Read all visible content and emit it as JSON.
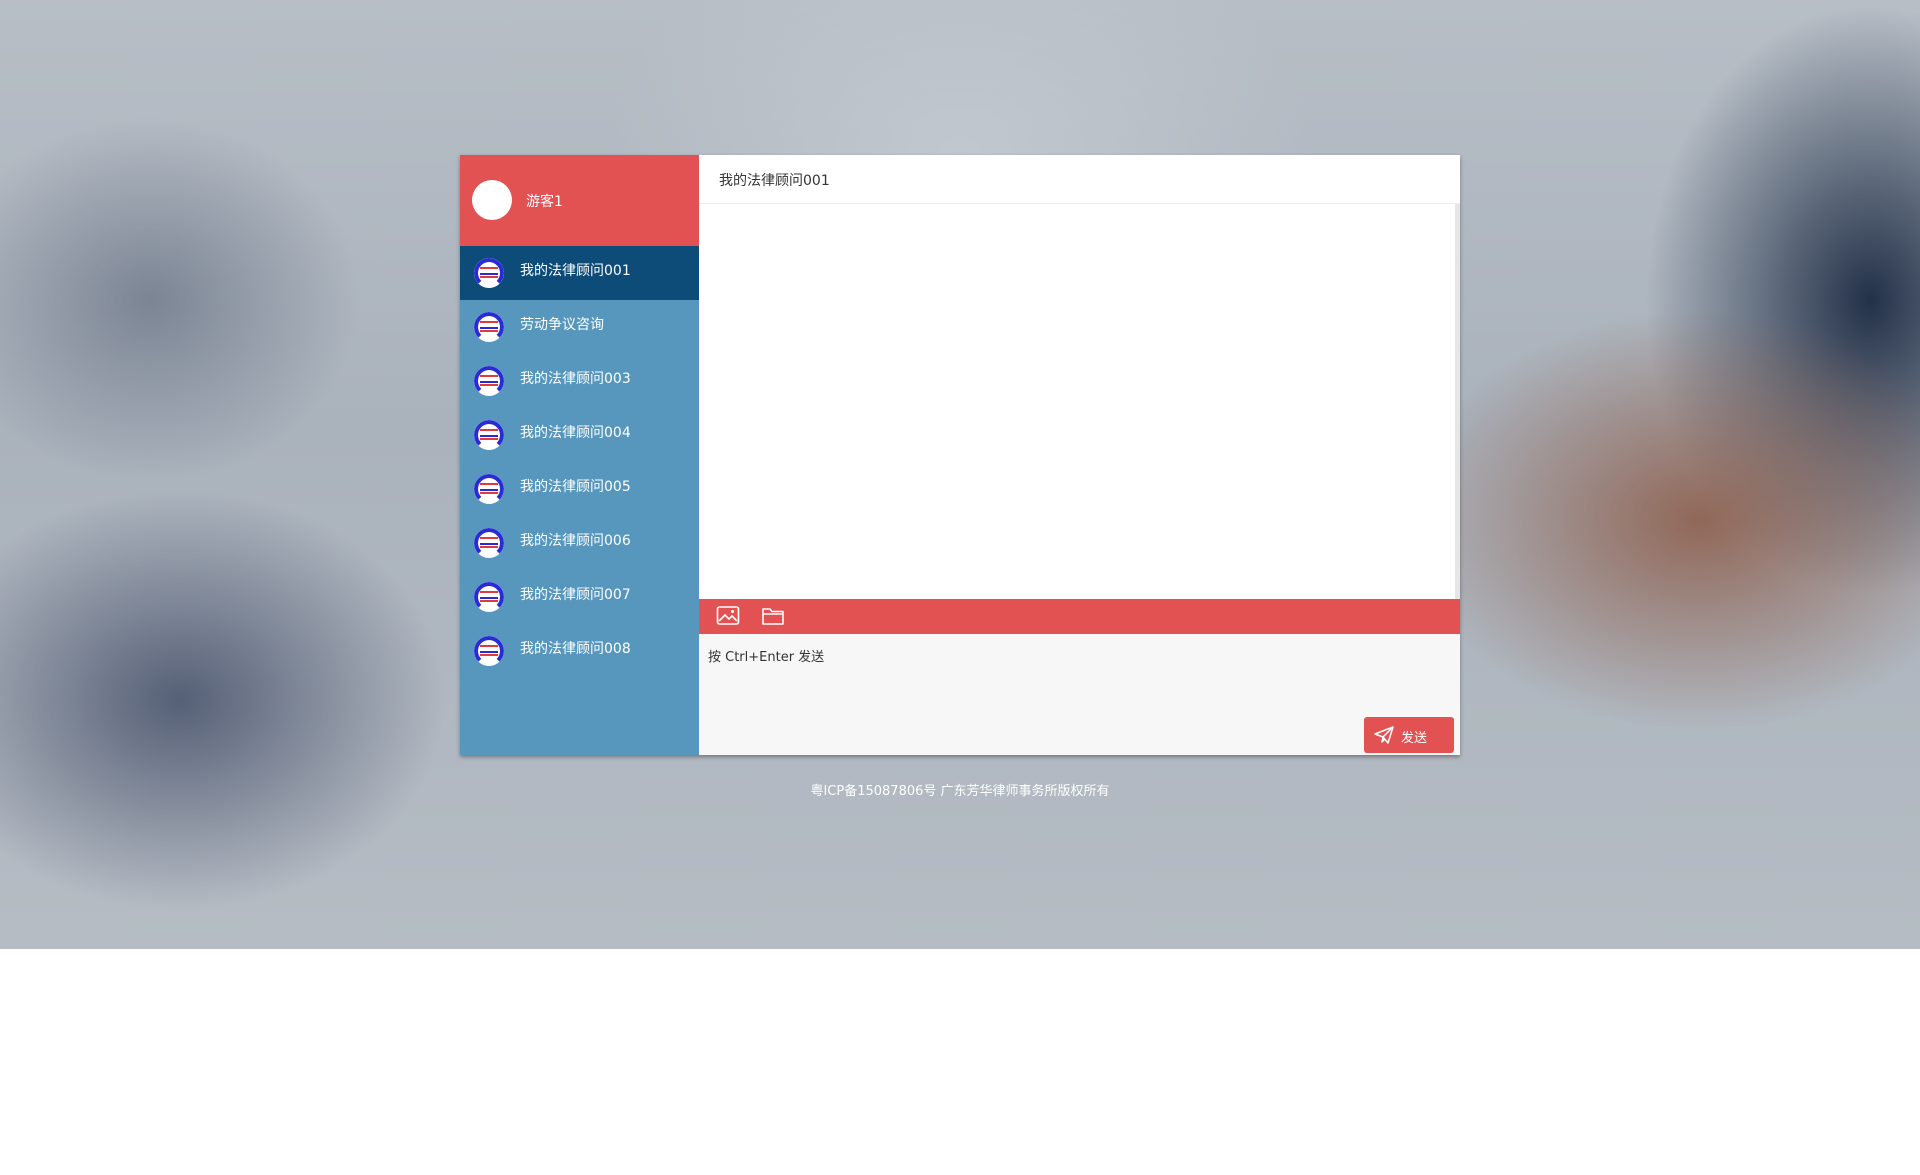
{
  "user": {
    "name": "游客1"
  },
  "contacts": [
    {
      "label": "我的法律顾问001",
      "active": true
    },
    {
      "label": "劳动争议咨询",
      "active": false
    },
    {
      "label": "我的法律顾问003",
      "active": false
    },
    {
      "label": "我的法律顾问004",
      "active": false
    },
    {
      "label": "我的法律顾问005",
      "active": false
    },
    {
      "label": "我的法律顾问006",
      "active": false
    },
    {
      "label": "我的法律顾问007",
      "active": false
    },
    {
      "label": "我的法律顾问008",
      "active": false
    }
  ],
  "chat": {
    "title": "我的法律顾问001"
  },
  "toolbar": {
    "icons": [
      "image-icon",
      "folder-icon"
    ]
  },
  "input": {
    "placeholder": "按 Ctrl+Enter 发送"
  },
  "send_button": {
    "label": "发送",
    "icon": "paper-plane-icon"
  },
  "footer": {
    "text": "粤ICP备15087806号 广东芳华律师事务所版权所有"
  },
  "colors": {
    "accent_red": "#e35252",
    "sidebar_blue": "#5797bd",
    "active_blue": "#0d4c79"
  }
}
